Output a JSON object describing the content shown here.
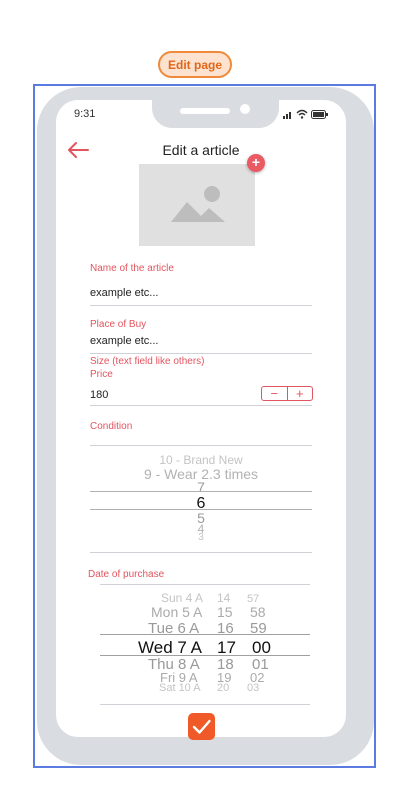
{
  "badge": {
    "label": "Edit page"
  },
  "status_bar": {
    "time": "9:31"
  },
  "header": {
    "title": "Edit a article"
  },
  "form": {
    "name_label": "Name of the article",
    "name_value": "example etc...",
    "place_label": "Place of Buy",
    "place_value": "example etc...",
    "size_label": "Size (text field like others)",
    "price_label": "Price",
    "price_value": "180",
    "stepper_minus": "−",
    "stepper_plus": "+",
    "condition_label": "Condition",
    "date_label": "Date of purchase"
  },
  "condition_picker": {
    "items": [
      "10 - Brand New",
      "9 - Wear 2.3 times",
      "7",
      "6",
      "5",
      "4",
      "3"
    ],
    "selected": "6"
  },
  "date_picker": {
    "days": [
      "Sun 4 A",
      "Mon 5 A",
      "Tue 6 A",
      "Wed 7 A",
      "Thu 8 A",
      "Fri 9 A",
      "Sat 10 A"
    ],
    "hours": [
      "14",
      "15",
      "16",
      "17",
      "18",
      "19",
      "20"
    ],
    "minutes": [
      "57",
      "58",
      "59",
      "00",
      "01",
      "02",
      "03"
    ],
    "selected_day": "Wed 7 A",
    "selected_hour": "17",
    "selected_minute": "00"
  },
  "colors": {
    "accent": "#e2545f",
    "confirm": "#f05a28",
    "frame": "#5c7be0",
    "badge": "#f08a3a"
  }
}
